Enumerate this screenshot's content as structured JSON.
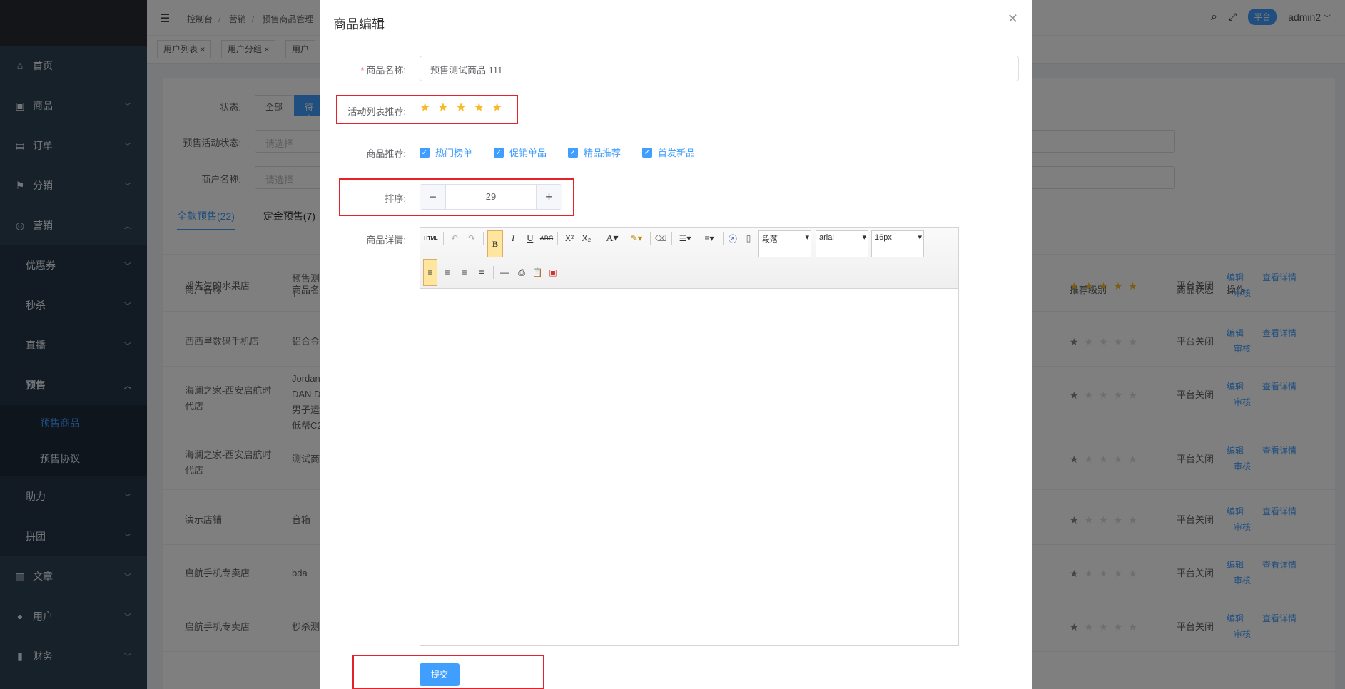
{
  "sidebar": {
    "items": [
      {
        "label": "首页",
        "icon": "home-icon"
      },
      {
        "label": "商品",
        "icon": "bag-icon"
      },
      {
        "label": "订单",
        "icon": "briefcase-icon"
      },
      {
        "label": "分销",
        "icon": "flag-icon"
      },
      {
        "label": "营销",
        "icon": "target-icon"
      }
    ],
    "marketing_sub": [
      "优惠券",
      "秒杀",
      "直播",
      "预售"
    ],
    "presale_sub": [
      "预售商品",
      "预售协议"
    ],
    "marketing_sub_after": [
      "助力",
      "拼团"
    ],
    "items_after": [
      {
        "label": "文章",
        "icon": "chart-icon"
      },
      {
        "label": "用户",
        "icon": "user-icon"
      },
      {
        "label": "财务",
        "icon": "bars-icon"
      }
    ]
  },
  "header": {
    "breadcrumb": [
      "控制台",
      "营销",
      "预售商品管理"
    ],
    "platform_badge": "平台",
    "user": "admin2"
  },
  "tags": [
    "用户列表",
    "用户分组",
    "用户"
  ],
  "filters": {
    "status_label": "状态:",
    "status_options": [
      "全部",
      "待审"
    ],
    "presale_status_label": "预售活动状态:",
    "presale_status_placeholder": "请选择",
    "merchant_label": "商户名称:",
    "merchant_placeholder": "请选择"
  },
  "tabs": [
    "全款预售(22)",
    "定金预售(7)"
  ],
  "table": {
    "headers": [
      "商户名称",
      "商品名",
      "推荐级别",
      "商品状态",
      "操作"
    ],
    "rows": [
      {
        "merchant": "邓先生的水果店",
        "product": "预售测\n1",
        "stars": 5,
        "status": "平台关闭"
      },
      {
        "merchant": "西西里数码手机店",
        "product": "铝合金",
        "stars": 1,
        "status": "平台关闭"
      },
      {
        "merchant": "海澜之家-西安启航时\n代店",
        "product": "Jordan\nDAN D\n男子运\n低帮C2",
        "stars": 1,
        "status": "平台关闭"
      },
      {
        "merchant": "海澜之家-西安启航时\n代店",
        "product": "测试商",
        "stars": 1,
        "status": "平台关闭"
      },
      {
        "merchant": "演示店铺",
        "product": "音箱",
        "stars": 1,
        "status": "平台关闭"
      },
      {
        "merchant": "启航手机专卖店",
        "product": "bda",
        "stars": 1,
        "status": "平台关闭"
      },
      {
        "merchant": "启航手机专卖店",
        "product": "秒杀测",
        "stars": 1,
        "status": "平台关闭"
      }
    ],
    "actions": {
      "edit": "编辑",
      "detail": "查看详情",
      "audit": "审核"
    }
  },
  "dialog": {
    "title": "商品编辑",
    "name_label": "商品名称:",
    "name_value": "预售测试商品 111",
    "activity_rec_label": "活动列表推荐:",
    "activity_rec_stars": 5,
    "rec_label": "商品推荐:",
    "rec_options": [
      "热门榜单",
      "促销单品",
      "精品推荐",
      "首发新品"
    ],
    "sort_label": "排序:",
    "sort_value": "29",
    "detail_label": "商品详情:",
    "editor": {
      "html_btn": "HTML",
      "paragraph": "段落",
      "font": "arial",
      "size": "16px"
    },
    "submit": "提交"
  }
}
